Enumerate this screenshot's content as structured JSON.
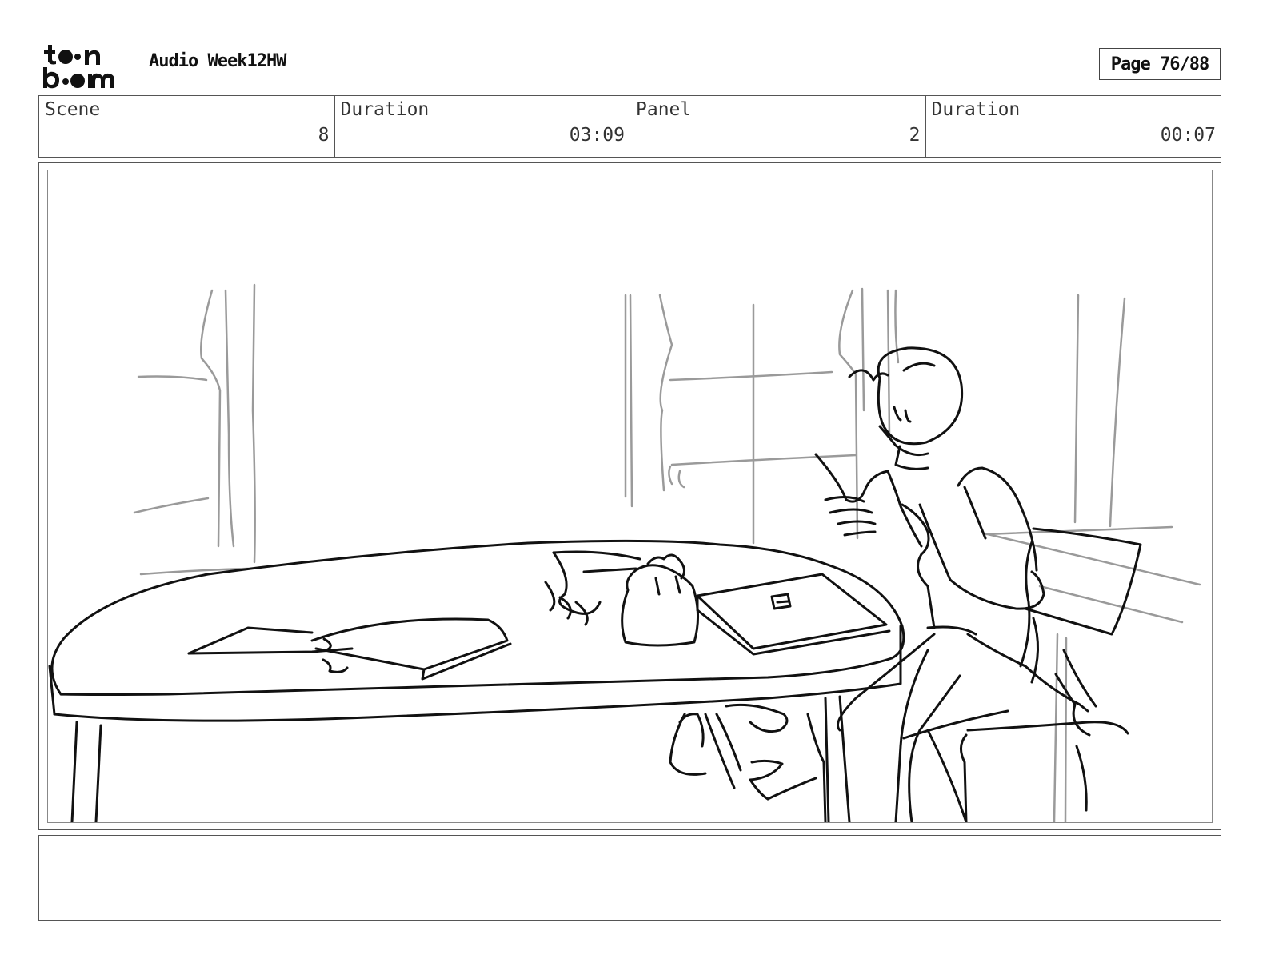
{
  "header": {
    "logo": {
      "text_line1": "t••n",
      "text_line2": "b••m",
      "icon": "toon-boom-logo"
    },
    "project_title": "Audio Week12HW",
    "page_label": "Page 76/88"
  },
  "info": [
    {
      "label": "Scene",
      "value": "8"
    },
    {
      "label": "Duration",
      "value": "03:09"
    },
    {
      "label": "Panel",
      "value": "2"
    },
    {
      "label": "Duration",
      "value": "00:07"
    }
  ],
  "panel": {
    "image": "storyboard-sketch-person-reading-at-table"
  },
  "notes": {
    "text": ""
  }
}
